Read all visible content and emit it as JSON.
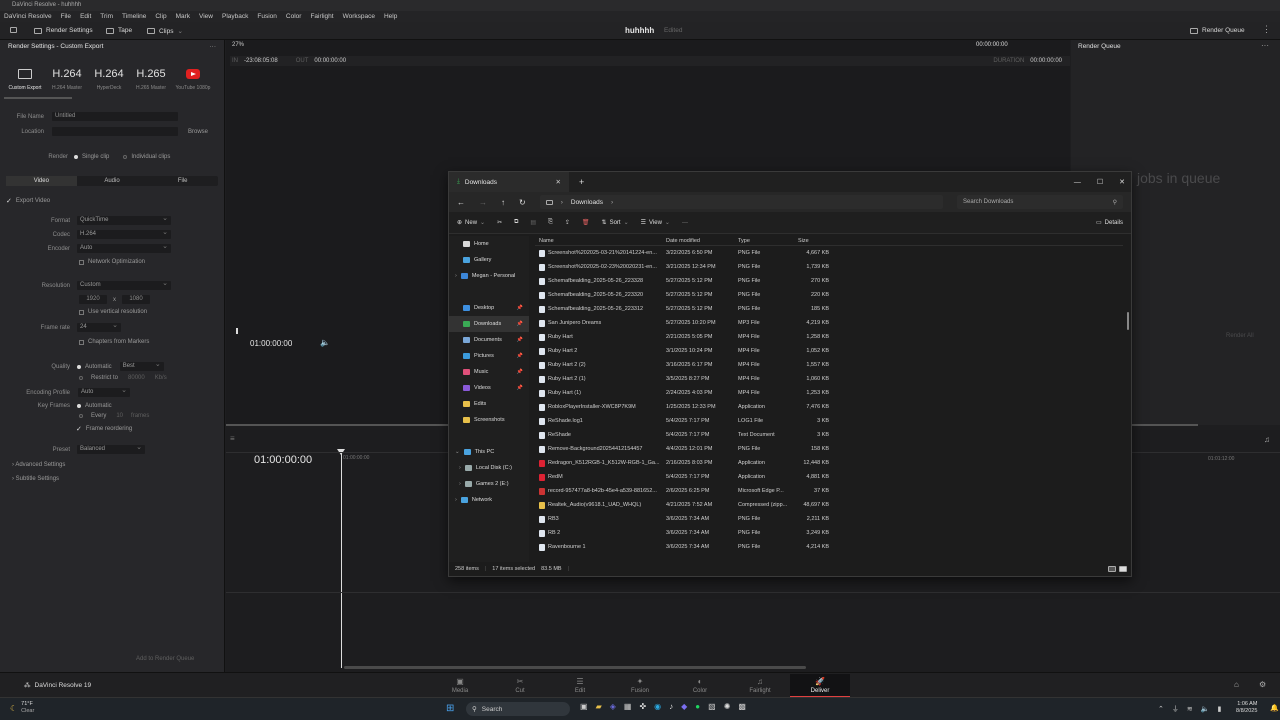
{
  "app": {
    "window_title": "DaVinci Resolve - huhhhh"
  },
  "menu": [
    "DaVinci Resolve",
    "File",
    "Edit",
    "Trim",
    "Timeline",
    "Clip",
    "Mark",
    "View",
    "Playback",
    "Fusion",
    "Color",
    "Fairlight",
    "Workspace",
    "Help"
  ],
  "toolbar": {
    "render_settings": "Render Settings",
    "tape": "Tape",
    "clips": "Clips",
    "project_name": "huhhhh",
    "edited": "Edited",
    "zoom": "27%",
    "timecode": "00:00:00:00",
    "render_queue": "Render Queue"
  },
  "render_panel": {
    "title": "Render Settings - Custom Export",
    "presets": [
      {
        "big": "",
        "label": "Custom Export"
      },
      {
        "big": "H.264",
        "label": "H.264 Master"
      },
      {
        "big": "H.264",
        "label": "HyperDeck"
      },
      {
        "big": "H.265",
        "label": "H.265 Master"
      },
      {
        "big": "",
        "label": "YouTube 1080p"
      }
    ],
    "file_name_label": "File Name",
    "file_name": "Untitled",
    "location_label": "Location",
    "browse": "Browse",
    "render_label": "Render",
    "single_clip": "Single clip",
    "individual_clips": "Individual clips",
    "tabs": [
      "Video",
      "Audio",
      "File"
    ],
    "export_video": "Export Video",
    "format_label": "Format",
    "format": "QuickTime",
    "codec_label": "Codec",
    "codec": "H.264",
    "encoder_label": "Encoder",
    "encoder": "Auto",
    "network_opt": "Network Optimization",
    "resolution_label": "Resolution",
    "resolution": "Custom",
    "res_w": "1920",
    "res_x": "x",
    "res_h": "1080",
    "vertical_res": "Use vertical resolution",
    "frame_rate_label": "Frame rate",
    "frame_rate": "24",
    "chapters": "Chapters from Markers",
    "quality_label": "Quality",
    "automatic": "Automatic",
    "best": "Best",
    "restrict_to": "Restrict to",
    "restrict_val": "80000",
    "kbs": "Kb/s",
    "enc_profile_label": "Encoding Profile",
    "enc_profile": "Auto",
    "key_frames_label": "Key Frames",
    "key_auto": "Automatic",
    "every": "Every",
    "every_val": "10",
    "frames": "frames",
    "frame_reorder": "Frame reordering",
    "preset_label": "Preset",
    "preset": "Balanced",
    "advanced": "Advanced Settings",
    "subtitle": "Subtitle Settings",
    "add_queue": "Add to Render Queue"
  },
  "viewer": {
    "in_label": "IN",
    "in_tc": "-23:08:05:08",
    "out_label": "OUT",
    "out_tc": "00:00:00:00",
    "duration_label": "DURATION",
    "duration": "00:00:00:00",
    "playhead_tc": "01:00:00:00"
  },
  "render_queue": {
    "empty": "jobs in queue",
    "render_all": "Render All"
  },
  "timeline": {
    "tc": "01:00:00:00",
    "ruler": [
      "01:00:00:00",
      "01:01:12:00"
    ]
  },
  "pages": [
    {
      "label": "Media",
      "icon": "▣"
    },
    {
      "label": "Cut",
      "icon": "✂"
    },
    {
      "label": "Edit",
      "icon": "☰"
    },
    {
      "label": "Fusion",
      "icon": "✦"
    },
    {
      "label": "Color",
      "icon": "◐"
    },
    {
      "label": "Fairlight",
      "icon": "♫"
    },
    {
      "label": "Deliver",
      "icon": "🚀"
    }
  ],
  "resolve_brand": "DaVinci Resolve 19",
  "explorer": {
    "tab_title": "Downloads",
    "path": "Downloads",
    "search_placeholder": "Search Downloads",
    "commands": {
      "new": "New",
      "sort": "Sort",
      "view": "View",
      "details": "Details"
    },
    "columns": [
      "Name",
      "Date modified",
      "Type",
      "Size"
    ],
    "sidebar": [
      {
        "label": "Home",
        "color": "#d9d9d9"
      },
      {
        "label": "Gallery",
        "color": "#4aa3df"
      },
      {
        "label": "Megan - Personal",
        "color": "#3c86d8"
      },
      {
        "label": "Desktop",
        "color": "#3d8fe0"
      },
      {
        "label": "Downloads",
        "color": "#3aaa55"
      },
      {
        "label": "Documents",
        "color": "#7aa7d8"
      },
      {
        "label": "Pictures",
        "color": "#3b9bdc"
      },
      {
        "label": "Music",
        "color": "#e0507a"
      },
      {
        "label": "Videos",
        "color": "#8a5ad8"
      },
      {
        "label": "Edits",
        "color": "#e8c04a"
      },
      {
        "label": "Screenshots",
        "color": "#e8c04a"
      },
      {
        "label": "This PC",
        "color": "#4aa3df"
      },
      {
        "label": "Local Disk (C:)",
        "color": "#9aa"
      },
      {
        "label": "Games 2 (E:)",
        "color": "#9aa"
      },
      {
        "label": "Network",
        "color": "#4aa3df"
      }
    ],
    "files": [
      {
        "name": "Screenshot%202025-03-21%20141224-en...",
        "date": "3/22/2025 6:50 PM",
        "type": "PNG File",
        "size": "4,667 KB"
      },
      {
        "name": "Screenshot%202025-02-23%20020231-en...",
        "date": "3/21/2025 12:34 PM",
        "type": "PNG File",
        "size": "1,739 KB"
      },
      {
        "name": "Schemafbealding_2025-05-26_223328",
        "date": "5/27/2025 5:12 PM",
        "type": "PNG File",
        "size": "270 KB"
      },
      {
        "name": "Schemafbealding_2025-05-26_223320",
        "date": "5/27/2025 5:12 PM",
        "type": "PNG File",
        "size": "220 KB"
      },
      {
        "name": "Schemafbealding_2025-05-26_223312",
        "date": "5/27/2025 5:12 PM",
        "type": "PNG File",
        "size": "185 KB"
      },
      {
        "name": "San Junipero Dreams",
        "date": "5/27/2025 10:20 PM",
        "type": "MP3 File",
        "size": "4,219 KB"
      },
      {
        "name": "Ruby Hart",
        "date": "2/21/2025 5:05 PM",
        "type": "MP4 File",
        "size": "1,258 KB"
      },
      {
        "name": "Ruby Hart 2",
        "date": "3/1/2025 10:24 PM",
        "type": "MP4 File",
        "size": "1,052 KB"
      },
      {
        "name": "Ruby Hart 2 (2)",
        "date": "3/16/2025 6:17 PM",
        "type": "MP4 File",
        "size": "1,557 KB"
      },
      {
        "name": "Ruby Hart 2 (1)",
        "date": "3/5/2025 8:27 PM",
        "type": "MP4 File",
        "size": "1,060 KB"
      },
      {
        "name": "Ruby Hart (1)",
        "date": "2/24/2025 4:03 PM",
        "type": "MP4 File",
        "size": "1,253 KB"
      },
      {
        "name": "RobloxPlayerInstaller-XWC8P7K9M",
        "date": "1/25/2025 12:33 PM",
        "type": "Application",
        "size": "7,476 KB"
      },
      {
        "name": "ReShade.log1",
        "date": "5/4/2025 7:17 PM",
        "type": "LOG1 File",
        "size": "3 KB"
      },
      {
        "name": "ReShade",
        "date": "5/4/2025 7:17 PM",
        "type": "Text Document",
        "size": "3 KB"
      },
      {
        "name": "Remove-Background20254412154457",
        "date": "4/4/2025 12:01 PM",
        "type": "PNG File",
        "size": "158 KB"
      },
      {
        "name": "Redragon_K512RGB-1_K512W-RGB-1_Ga...",
        "date": "2/16/2025 8:03 PM",
        "type": "Application",
        "size": "12,448 KB"
      },
      {
        "name": "RedM",
        "date": "5/4/2025 7:17 PM",
        "type": "Application",
        "size": "4,881 KB"
      },
      {
        "name": "record-957477a8-b42b-45e4-a539-881652...",
        "date": "2/6/2025 6:25 PM",
        "type": "Microsoft Edge P...",
        "size": "37 KB"
      },
      {
        "name": "Realtek_Audio(v9618.1_UAD_WHQL)",
        "date": "4/21/2025 7:52 AM",
        "type": "Compressed (zipp...",
        "size": "48,697 KB"
      },
      {
        "name": "RB3",
        "date": "3/6/2025 7:34 AM",
        "type": "PNG File",
        "size": "2,211 KB"
      },
      {
        "name": "RB 2",
        "date": "3/6/2025 7:34 AM",
        "type": "PNG File",
        "size": "3,249 KB"
      },
      {
        "name": "Ravenbourne 1",
        "date": "3/6/2025 7:34 AM",
        "type": "PNG File",
        "size": "4,214 KB"
      }
    ],
    "status": {
      "items": "258 items",
      "selected": "17 items selected",
      "size": "83.5 MB"
    }
  },
  "taskbar": {
    "weather_temp": "71°F",
    "weather_desc": "Clear",
    "search": "Search",
    "time": "1:06 AM",
    "date": "8/8/2025"
  }
}
